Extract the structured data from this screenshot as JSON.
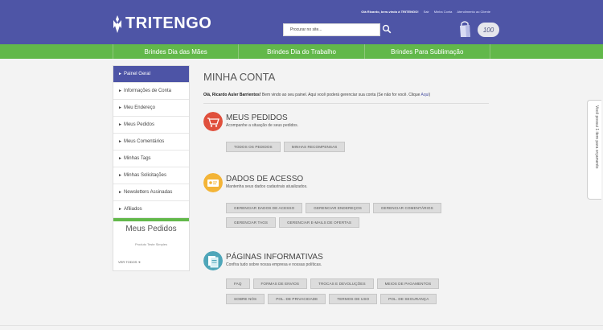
{
  "header": {
    "greeting": "Olá Ricardo, bem-vindo à TRITENGO!",
    "links": [
      "Sair",
      "Minha Conta",
      "Atendimento ao Cliente"
    ],
    "logo_text": "TRITENGO",
    "search_placeholder": "Procurar no site...",
    "cart_count": "100"
  },
  "nav": [
    "Brindes Dia das Mães",
    "Brindes Dia do Trabalho",
    "Brindes Para Sublimação"
  ],
  "sidebar": {
    "items": [
      "Painel Geral",
      "Informações de Conta",
      "Meu Endereço",
      "Meus Pedidos",
      "Meus Comentários",
      "Minhas Tags",
      "Minhas Solicitações",
      "Newsletters Assinadas",
      "Afiliados"
    ],
    "orders_title": "Meus Pedidos",
    "product": "Produto Teste Simples",
    "see_all": "VER TODOS"
  },
  "main": {
    "title": "MINHA CONTA",
    "intro_name": "Olá, Ricardo Auler Barrientos!",
    "intro_text": " Bem vindo ao seu painel. Aqui você poderá gerenciar sua conta (Se não for você. Clique ",
    "intro_link": "Aqui",
    "intro_end": ")",
    "sections": [
      {
        "title": "MEUS PEDIDOS",
        "subtitle": "Acompanhe a situação de seus pedidos.",
        "buttons": [
          [
            "TODOS OS PEDIDOS",
            "MINHAS RECOMPENSAS"
          ]
        ]
      },
      {
        "title": "DADOS DE ACESSO",
        "subtitle": "Mantenha seus dados cadastrais atualizados.",
        "buttons": [
          [
            "GERENCIAR DADOS DE ACESSO",
            "GERENCIAR ENDEREÇOS",
            "GERENCIAR COMENTÁRIOS"
          ],
          [
            "GERENCIAR TAGS",
            "GERENCIAR E-MAILS DE OFERTAS"
          ]
        ]
      },
      {
        "title": "PÁGINAS INFORMATIVAS",
        "subtitle": "Confira tudo sobre nossa empresa e nossas políticas.",
        "buttons": [
          [
            "FAQ",
            "FORMAS DE ENVIOS",
            "TROCAS E DEVOLUÇÕES",
            "MEIOS DE PAGAMENTOS"
          ],
          [
            "SOBRE NÓS",
            "POL. DE PRIVACIDADE",
            "TERMOS DE USO",
            "POL. DE SEGURANÇA"
          ]
        ]
      }
    ]
  },
  "side_tab": "Você possui 1 item para orçamento",
  "colors": {
    "brand_purple": "#4e55a6",
    "brand_green": "#62b84a",
    "icon_red": "#e0503d",
    "icon_yellow": "#f3b437",
    "icon_teal": "#4fa6b9"
  }
}
